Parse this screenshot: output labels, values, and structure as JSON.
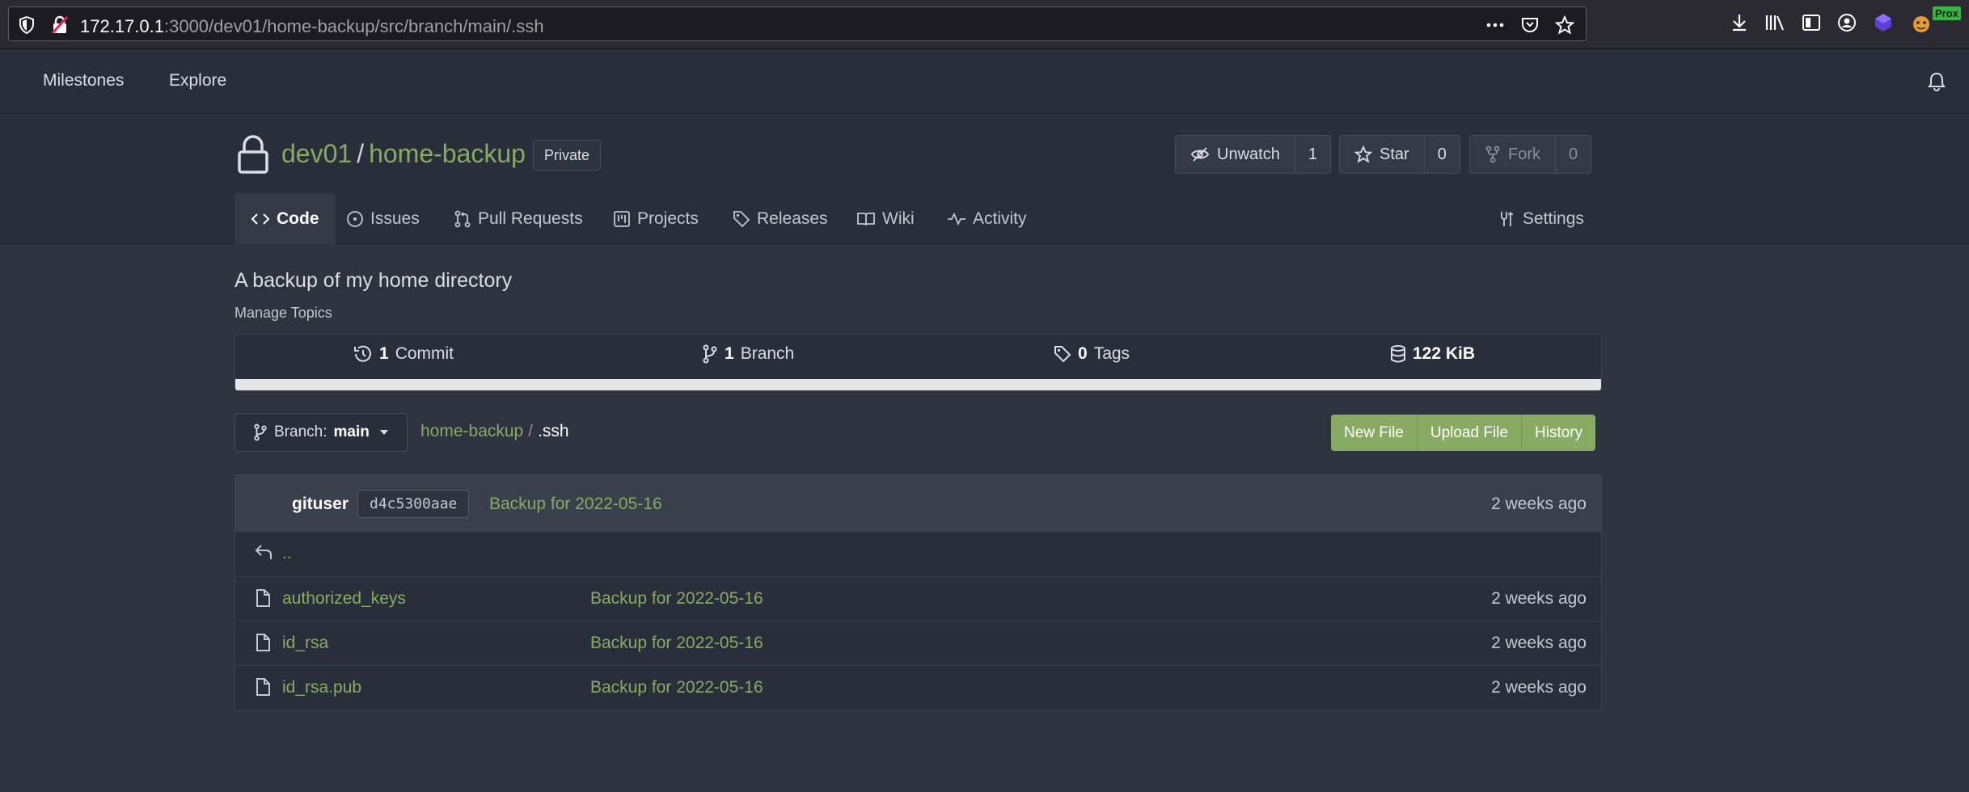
{
  "browser": {
    "url_host": "172.17.0.1",
    "url_path": ":3000/dev01/home-backup/src/branch/main/.ssh",
    "extension_badge": "Prox"
  },
  "nav": {
    "items": [
      "Milestones",
      "Explore"
    ]
  },
  "repo": {
    "owner": "dev01",
    "separator": "/",
    "name": "home-backup",
    "visibility": "Private",
    "watch": {
      "label": "Unwatch",
      "count": "1"
    },
    "star": {
      "label": "Star",
      "count": "0"
    },
    "fork": {
      "label": "Fork",
      "count": "0"
    },
    "tabs": [
      "Code",
      "Issues",
      "Pull Requests",
      "Projects",
      "Releases",
      "Wiki",
      "Activity"
    ],
    "settings_label": "Settings",
    "description": "A backup of my home directory",
    "manage_topics": "Manage Topics"
  },
  "stats": {
    "commits": {
      "count": "1",
      "label": "Commit"
    },
    "branches": {
      "count": "1",
      "label": "Branch"
    },
    "tags": {
      "count": "0",
      "label": "Tags"
    },
    "size": "122 KiB"
  },
  "toolbar": {
    "branch_prefix": "Branch:",
    "branch_name": "main",
    "breadcrumb_root": "home-backup",
    "breadcrumb_divider": "/",
    "breadcrumb_current": ".ssh",
    "actions": [
      "New File",
      "Upload File",
      "History"
    ]
  },
  "latest_commit": {
    "author": "gituser",
    "sha": "d4c5300aae",
    "message": "Backup for 2022-05-16",
    "time": "2 weeks ago"
  },
  "parent_dir_label": "..",
  "files": [
    {
      "name": "authorized_keys",
      "message": "Backup for 2022-05-16",
      "time": "2 weeks ago"
    },
    {
      "name": "id_rsa",
      "message": "Backup for 2022-05-16",
      "time": "2 weeks ago"
    },
    {
      "name": "id_rsa.pub",
      "message": "Backup for 2022-05-16",
      "time": "2 weeks ago"
    }
  ],
  "colors": {
    "accent_green": "#87ab63",
    "background": "#2f333e",
    "header_bg": "#2a2e3a"
  }
}
